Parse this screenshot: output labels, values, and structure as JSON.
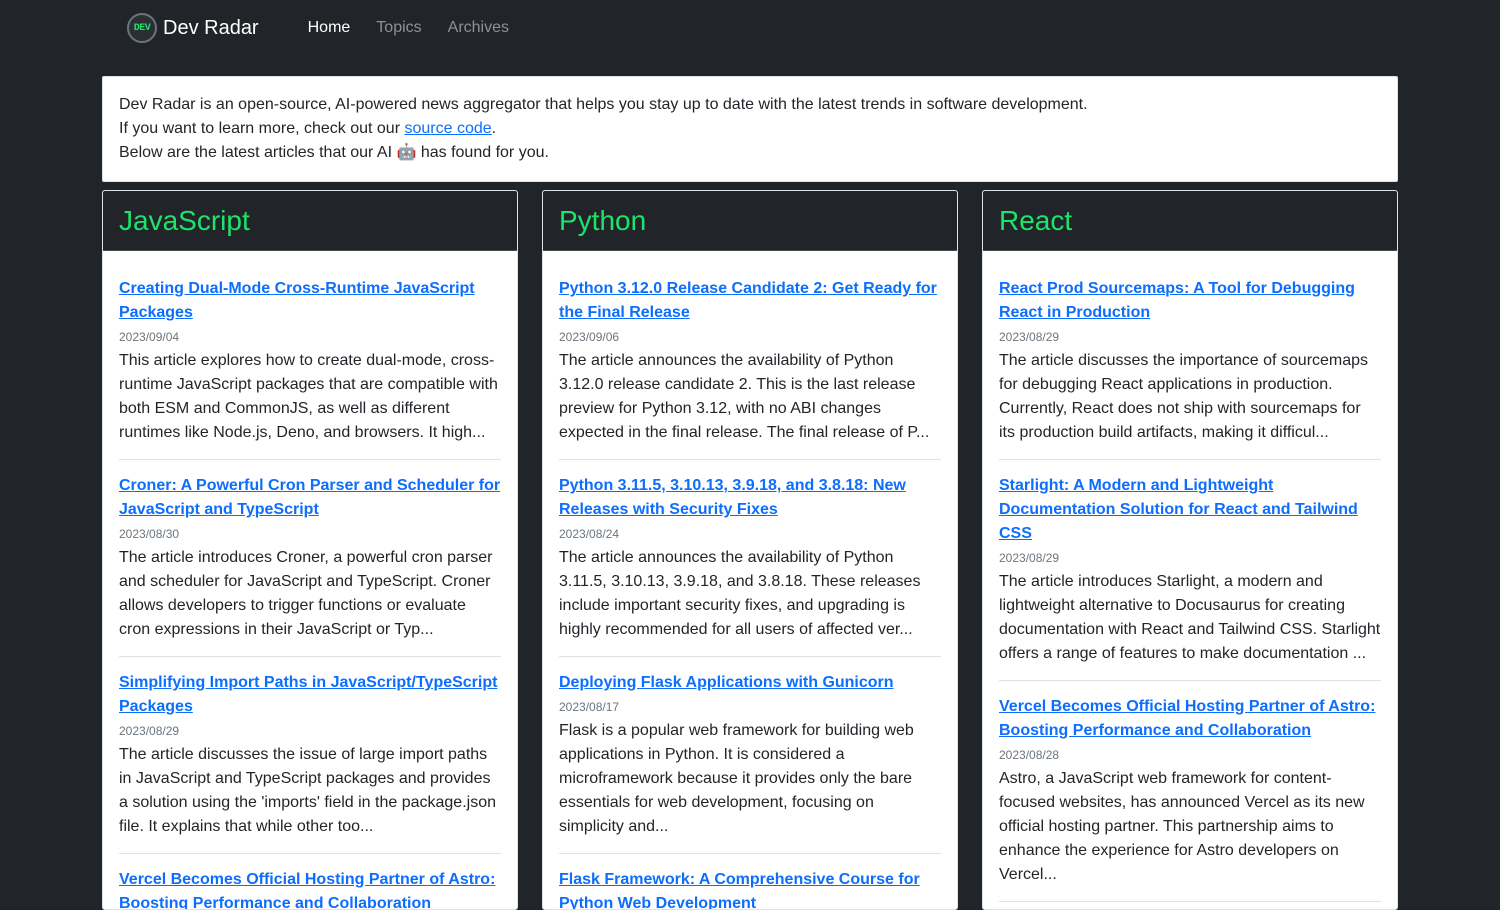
{
  "nav": {
    "logo_text": "DEV",
    "brand": "Dev Radar",
    "links": [
      "Home",
      "Topics",
      "Archives"
    ]
  },
  "intro": {
    "line1": "Dev Radar is an open-source, AI-powered news aggregator that helps you stay up to date with the latest trends in software development.",
    "line2_prefix": "If you want to learn more, check out our ",
    "line2_link": "source code",
    "line2_suffix": ".",
    "line3": "Below are the latest articles that our AI 🤖 has found for you."
  },
  "columns": [
    {
      "title": "JavaScript",
      "articles": [
        {
          "title": "Creating Dual-Mode Cross-Runtime JavaScript Packages",
          "date": "2023/09/04",
          "summary": "This article explores how to create dual-mode, cross-runtime JavaScript packages that are compatible with both ESM and CommonJS, as well as different runtimes like Node.js, Deno, and browsers. It high..."
        },
        {
          "title": "Croner: A Powerful Cron Parser and Scheduler for JavaScript and TypeScript",
          "date": "2023/08/30",
          "summary": "The article introduces Croner, a powerful cron parser and scheduler for JavaScript and TypeScript. Croner allows developers to trigger functions or evaluate cron expressions in their JavaScript or Typ..."
        },
        {
          "title": "Simplifying Import Paths in JavaScript/TypeScript Packages",
          "date": "2023/08/29",
          "summary": "The article discusses the issue of large import paths in JavaScript and TypeScript packages and provides a solution using the 'imports' field in the package.json file. It explains that while other too..."
        },
        {
          "title": "Vercel Becomes Official Hosting Partner of Astro: Boosting Performance and Collaboration",
          "date": "",
          "summary": ""
        }
      ]
    },
    {
      "title": "Python",
      "articles": [
        {
          "title": "Python 3.12.0 Release Candidate 2: Get Ready for the Final Release",
          "date": "2023/09/06",
          "summary": "The article announces the availability of Python 3.12.0 release candidate 2. This is the last release preview for Python 3.12, with no ABI changes expected in the final release. The final release of P..."
        },
        {
          "title": "Python 3.11.5, 3.10.13, 3.9.18, and 3.8.18: New Releases with Security Fixes",
          "date": "2023/08/24",
          "summary": "The article announces the availability of Python 3.11.5, 3.10.13, 3.9.18, and 3.8.18. These releases include important security fixes, and upgrading is highly recommended for all users of affected ver..."
        },
        {
          "title": "Deploying Flask Applications with Gunicorn",
          "date": "2023/08/17",
          "summary": "Flask is a popular web framework for building web applications in Python. It is considered a microframework because it provides only the bare essentials for web development, focusing on simplicity and..."
        },
        {
          "title": "Flask Framework: A Comprehensive Course for Python Web Development",
          "date": "",
          "summary": ""
        }
      ]
    },
    {
      "title": "React",
      "articles": [
        {
          "title": "React Prod Sourcemaps: A Tool for Debugging React in Production",
          "date": "2023/08/29",
          "summary": "The article discusses the importance of sourcemaps for debugging React applications in production. Currently, React does not ship with sourcemaps for its production build artifacts, making it difficul..."
        },
        {
          "title": "Starlight: A Modern and Lightweight Documentation Solution for React and Tailwind CSS",
          "date": "2023/08/29",
          "summary": "The article introduces Starlight, a modern and lightweight alternative to Docusaurus for creating documentation with React and Tailwind CSS. Starlight offers a range of features to make documentation ..."
        },
        {
          "title": "Vercel Becomes Official Hosting Partner of Astro: Boosting Performance and Collaboration",
          "date": "2023/08/28",
          "summary": "Astro, a JavaScript web framework for content-focused websites, has announced Vercel as its new official hosting partner. This partnership aims to enhance the experience for Astro developers on Vercel..."
        }
      ]
    }
  ],
  "colors": {
    "background": "#212529",
    "accent_green": "#1ee36b",
    "link_blue": "#0d6efd"
  }
}
